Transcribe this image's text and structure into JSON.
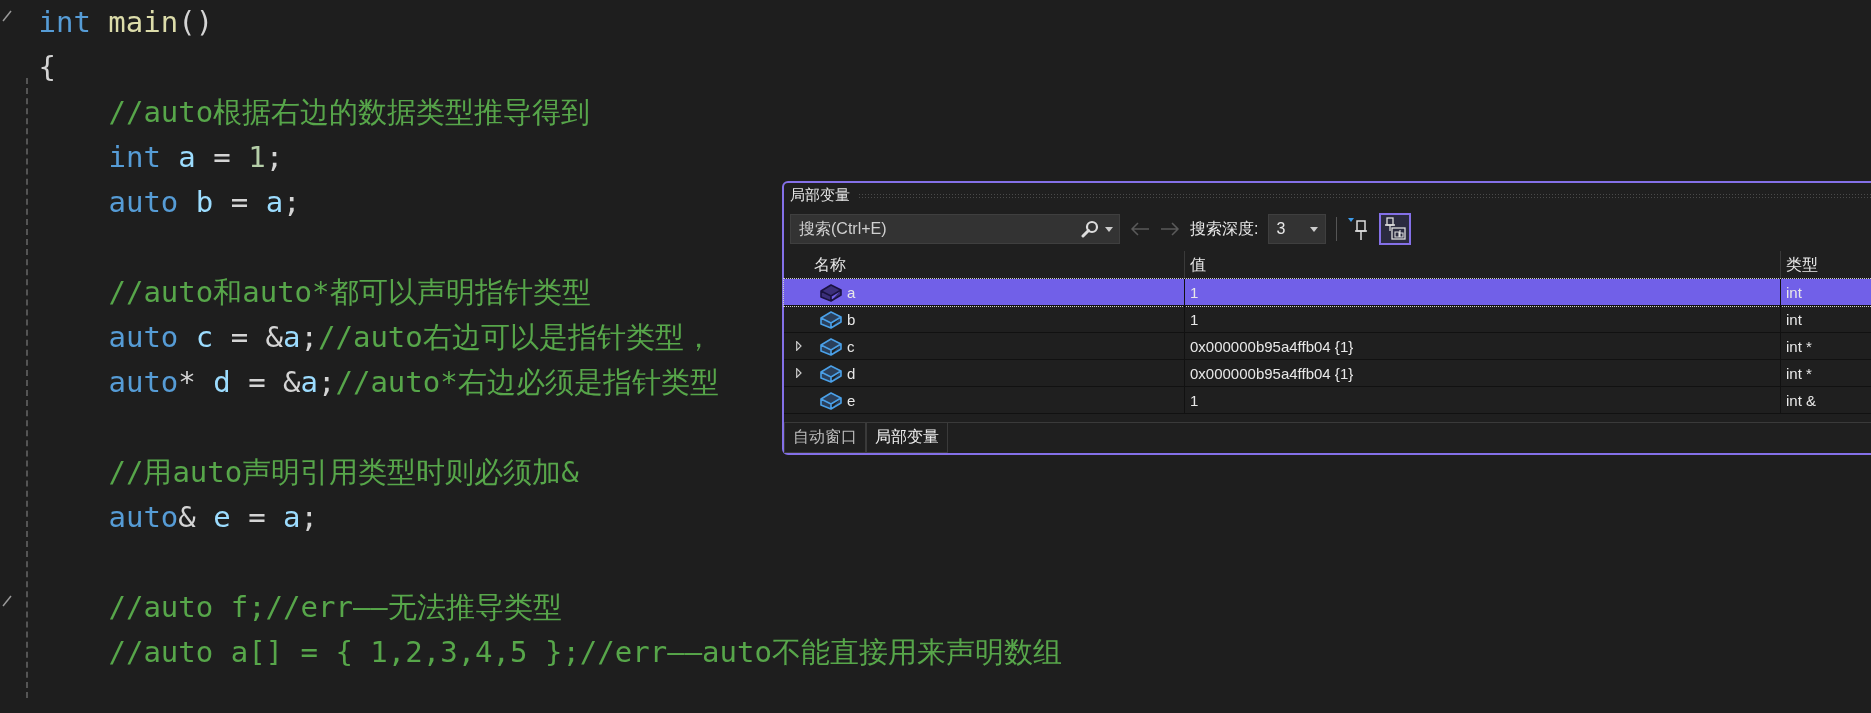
{
  "editor": {
    "lines": [
      {
        "fold": true,
        "gap_before": false,
        "indent": false,
        "tokens": [
          {
            "kind": "keyword",
            "text": "int"
          },
          {
            "kind": "function",
            "text": " main"
          },
          {
            "kind": "plain",
            "text": "()"
          }
        ]
      },
      {
        "fold": false,
        "gap_before": false,
        "indent": false,
        "tokens": [
          {
            "kind": "plain",
            "text": "{"
          }
        ]
      },
      {
        "fold": false,
        "gap_before": false,
        "indent": true,
        "tokens": [
          {
            "kind": "comment",
            "text": "//auto根据右边的数据类型推导得到"
          }
        ]
      },
      {
        "fold": false,
        "gap_before": false,
        "indent": true,
        "tokens": [
          {
            "kind": "keyword",
            "text": "int"
          },
          {
            "kind": "variable",
            "text": " a"
          },
          {
            "kind": "plain",
            "text": " = "
          },
          {
            "kind": "number",
            "text": "1"
          },
          {
            "kind": "plain",
            "text": ";"
          }
        ]
      },
      {
        "fold": false,
        "gap_before": false,
        "indent": true,
        "tokens": [
          {
            "kind": "keyword",
            "text": "auto"
          },
          {
            "kind": "variable",
            "text": " b"
          },
          {
            "kind": "plain",
            "text": " = "
          },
          {
            "kind": "variable",
            "text": "a"
          },
          {
            "kind": "plain",
            "text": ";"
          }
        ]
      },
      {
        "fold": false,
        "gap_before": true,
        "indent": true,
        "tokens": [
          {
            "kind": "comment",
            "text": "//auto和auto*都可以声明指针类型"
          }
        ]
      },
      {
        "fold": false,
        "gap_before": false,
        "indent": true,
        "tokens": [
          {
            "kind": "keyword",
            "text": "auto"
          },
          {
            "kind": "variable",
            "text": " c"
          },
          {
            "kind": "plain",
            "text": " = &"
          },
          {
            "kind": "variable",
            "text": "a"
          },
          {
            "kind": "plain",
            "text": ";"
          },
          {
            "kind": "comment",
            "text": "//auto右边可以是指针类型，"
          }
        ]
      },
      {
        "fold": false,
        "gap_before": false,
        "indent": true,
        "tokens": [
          {
            "kind": "keyword",
            "text": "auto"
          },
          {
            "kind": "plain",
            "text": "* "
          },
          {
            "kind": "variable",
            "text": "d"
          },
          {
            "kind": "plain",
            "text": " = &"
          },
          {
            "kind": "variable",
            "text": "a"
          },
          {
            "kind": "plain",
            "text": ";"
          },
          {
            "kind": "comment",
            "text": "//auto*右边必须是指针类型"
          }
        ]
      },
      {
        "fold": false,
        "gap_before": true,
        "indent": true,
        "tokens": [
          {
            "kind": "comment",
            "text": "//用auto声明引用类型时则必须加&"
          }
        ]
      },
      {
        "fold": false,
        "gap_before": false,
        "indent": true,
        "tokens": [
          {
            "kind": "keyword",
            "text": "auto"
          },
          {
            "kind": "plain",
            "text": "& "
          },
          {
            "kind": "variable",
            "text": "e"
          },
          {
            "kind": "plain",
            "text": " = "
          },
          {
            "kind": "variable",
            "text": "a"
          },
          {
            "kind": "plain",
            "text": ";"
          }
        ]
      },
      {
        "fold": true,
        "gap_before": true,
        "indent": true,
        "tokens": [
          {
            "kind": "comment",
            "text": "//auto f;//err——无法推导类型"
          }
        ]
      },
      {
        "fold": false,
        "gap_before": false,
        "indent": true,
        "tokens": [
          {
            "kind": "comment",
            "text": "//auto a[] = { 1,2,3,4,5 };//err——auto不能直接用来声明数组"
          }
        ]
      }
    ]
  },
  "locals_window": {
    "title": "局部变量",
    "search": {
      "placeholder": "搜索(Ctrl+E)"
    },
    "back_disabled": true,
    "forward_disabled": true,
    "depth_label": "搜索深度:",
    "depth_value": "3",
    "hex_toggle_on": true,
    "columns": [
      "名称",
      "值",
      "类型"
    ],
    "rows": [
      {
        "name": "a",
        "value": "1",
        "type": "int",
        "expandable": false,
        "selected": true
      },
      {
        "name": "b",
        "value": "1",
        "type": "int",
        "expandable": false,
        "selected": false
      },
      {
        "name": "c",
        "value": "0x000000b95a4ffb04 {1}",
        "type": "int *",
        "expandable": true,
        "selected": false
      },
      {
        "name": "d",
        "value": "0x000000b95a4ffb04 {1}",
        "type": "int *",
        "expandable": true,
        "selected": false
      },
      {
        "name": "e",
        "value": "1",
        "type": "int &",
        "expandable": false,
        "selected": false
      }
    ],
    "tabs": [
      {
        "label": "自动窗口",
        "selected": false
      },
      {
        "label": "局部变量",
        "selected": true
      }
    ]
  }
}
